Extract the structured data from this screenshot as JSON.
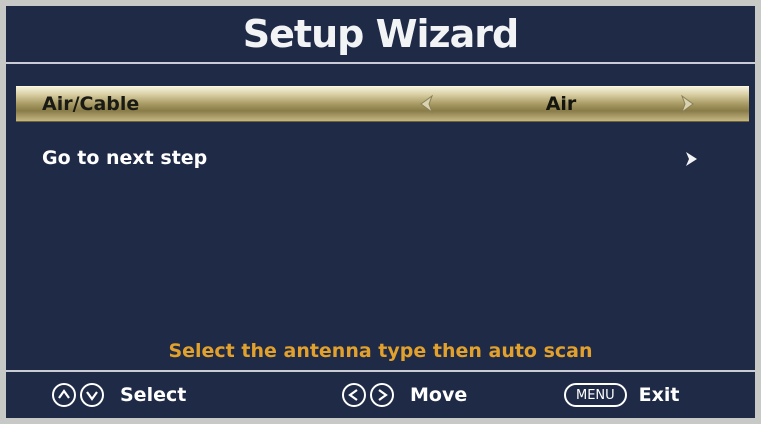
{
  "title": "Setup Wizard",
  "menu": {
    "items": [
      {
        "label": "Air/Cable",
        "value": "Air",
        "selected": true
      },
      {
        "label": "Go to next step",
        "selected": false
      }
    ]
  },
  "hint": "Select the antenna type then auto scan",
  "footer": {
    "select_label": "Select",
    "move_label": "Move",
    "menu_key": "MENU",
    "exit_label": "Exit"
  },
  "colors": {
    "background": "#1f2a47",
    "hint": "#e2a12c",
    "highlight": "#a89a63"
  },
  "icons": [
    "up-circle-icon",
    "down-circle-icon",
    "left-arrow-icon",
    "right-arrow-icon",
    "chevron-right-icon",
    "left-circle-icon",
    "right-circle-icon"
  ]
}
